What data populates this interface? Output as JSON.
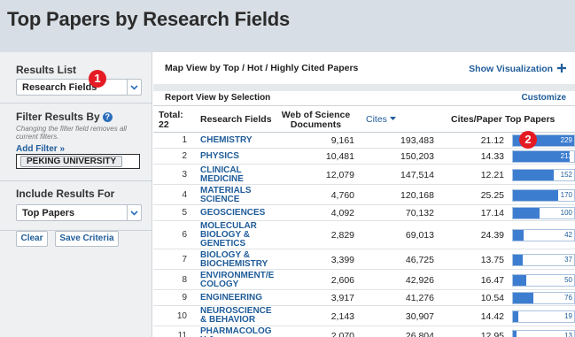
{
  "header": {
    "title": "Top Papers by Research Fields"
  },
  "sidebar": {
    "results_list": {
      "label": "Results List",
      "value": "Research Fields"
    },
    "filter": {
      "label": "Filter Results By",
      "hint": "Changing the filter field removes all current filters.",
      "add_filter": "Add Filter »",
      "chip": "PEKING UNIVERSITY"
    },
    "include": {
      "label": "Include Results For",
      "value": "Top Papers"
    },
    "buttons": {
      "clear": "Clear",
      "save": "Save Criteria"
    }
  },
  "markers": {
    "one": "1",
    "two": "2"
  },
  "main": {
    "map_title": "Map View by Top / Hot / Highly Cited Papers",
    "show_visualization": "Show Visualization",
    "report_title": "Report View by Selection",
    "customize": "Customize",
    "columns": {
      "total_label": "Total:",
      "total_value": "22",
      "field": "Research Fields",
      "wos": "Web of Science Documents",
      "cites": "Cites",
      "cpp": "Cites/Paper",
      "top": "Top Papers"
    },
    "rows": [
      {
        "n": "1",
        "field": "CHEMISTRY",
        "wos": "9,161",
        "cites": "193,483",
        "cpp": "21.12",
        "top": "229",
        "frac": 1.0
      },
      {
        "n": "2",
        "field": "PHYSICS",
        "wos": "10,481",
        "cites": "150,203",
        "cpp": "14.33",
        "top": "213",
        "frac": 0.93
      },
      {
        "n": "3",
        "field": "CLINICAL MEDICINE",
        "wos": "12,079",
        "cites": "147,514",
        "cpp": "12.21",
        "top": "152",
        "frac": 0.66
      },
      {
        "n": "4",
        "field": "MATERIALS SCIENCE",
        "wos": "4,760",
        "cites": "120,168",
        "cpp": "25.25",
        "top": "170",
        "frac": 0.74
      },
      {
        "n": "5",
        "field": "GEOSCIENCES",
        "wos": "4,092",
        "cites": "70,132",
        "cpp": "17.14",
        "top": "100",
        "frac": 0.44
      },
      {
        "n": "6",
        "field": "MOLECULAR BIOLOGY & GENETICS",
        "wos": "2,829",
        "cites": "69,013",
        "cpp": "24.39",
        "top": "42",
        "frac": 0.18
      },
      {
        "n": "7",
        "field": "BIOLOGY & BIOCHEMISTRY",
        "wos": "3,399",
        "cites": "46,725",
        "cpp": "13.75",
        "top": "37",
        "frac": 0.16
      },
      {
        "n": "8",
        "field": "ENVIRONMENT/E COLOGY",
        "wos": "2,606",
        "cites": "42,926",
        "cpp": "16.47",
        "top": "50",
        "frac": 0.22
      },
      {
        "n": "9",
        "field": "ENGINEERING",
        "wos": "3,917",
        "cites": "41,276",
        "cpp": "10.54",
        "top": "76",
        "frac": 0.33
      },
      {
        "n": "10",
        "field": "NEUROSCIENCE & BEHAVIOR",
        "wos": "2,143",
        "cites": "30,907",
        "cpp": "14.42",
        "top": "19",
        "frac": 0.08
      },
      {
        "n": "11",
        "field": "PHARMACOLOG Y & TOXICOLOGY",
        "wos": "2,070",
        "cites": "26,804",
        "cpp": "12.95",
        "top": "13",
        "frac": 0.06
      }
    ]
  },
  "colors": {
    "link": "#1f5c99",
    "bar": "#3d7dd0",
    "marker": "#e51b24",
    "header_bg": "#d8dee5"
  }
}
